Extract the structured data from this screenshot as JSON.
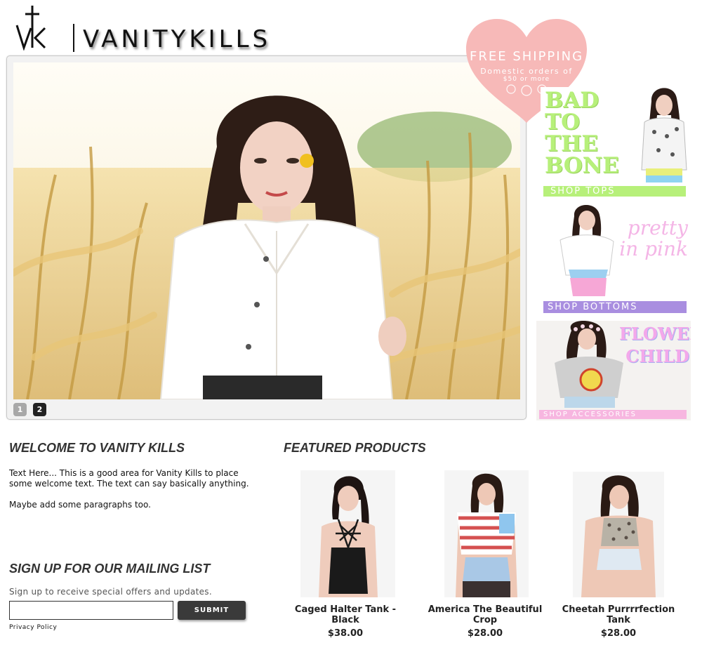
{
  "brand": {
    "logo_text": "VANITYKILLS",
    "logo_mark": "VK cross monogram"
  },
  "colors": {
    "accent_pink": "#f7b9b8",
    "banner_green": "#b7f07a",
    "banner_purple": "#a98ee0",
    "banner_pink": "#f7b6e0",
    "button_dark": "#3a3a3a"
  },
  "slider": {
    "pages": [
      "1",
      "2"
    ],
    "active_page": "2"
  },
  "shipping": {
    "title": "FREE SHIPPING",
    "line1": "Domestic orders of",
    "line2": "$50 or more"
  },
  "banners": [
    {
      "headline": "BAD TO THE BONE",
      "cta": "SHOP TOPS"
    },
    {
      "headline": "pretty in pink",
      "cta": "SHOP BOTTOMS"
    },
    {
      "headline": "FLOWER CHILD",
      "cta": "SHOP ACCESSORIES"
    }
  ],
  "welcome": {
    "title": "WELCOME TO VANITY KILLS",
    "paragraph1": "Text Here... This is a good area for Vanity Kills to place some welcome text. The text can say basically anything.",
    "paragraph2": "Maybe add some paragraphs too."
  },
  "mailing": {
    "title": "SIGN UP FOR OUR MAILING LIST",
    "description": "Sign up to receive special offers and updates.",
    "input_value": "",
    "submit_label": "SUBMIT",
    "privacy_label": "Privacy Policy"
  },
  "featured": {
    "title": "FEATURED PRODUCTS",
    "products": [
      {
        "name": "Caged Halter Tank - Black",
        "price": "$38.00"
      },
      {
        "name": "America The Beautiful Crop",
        "price": "$28.00"
      },
      {
        "name": "Cheetah Purrrrfection Tank",
        "price": "$28.00"
      }
    ]
  }
}
